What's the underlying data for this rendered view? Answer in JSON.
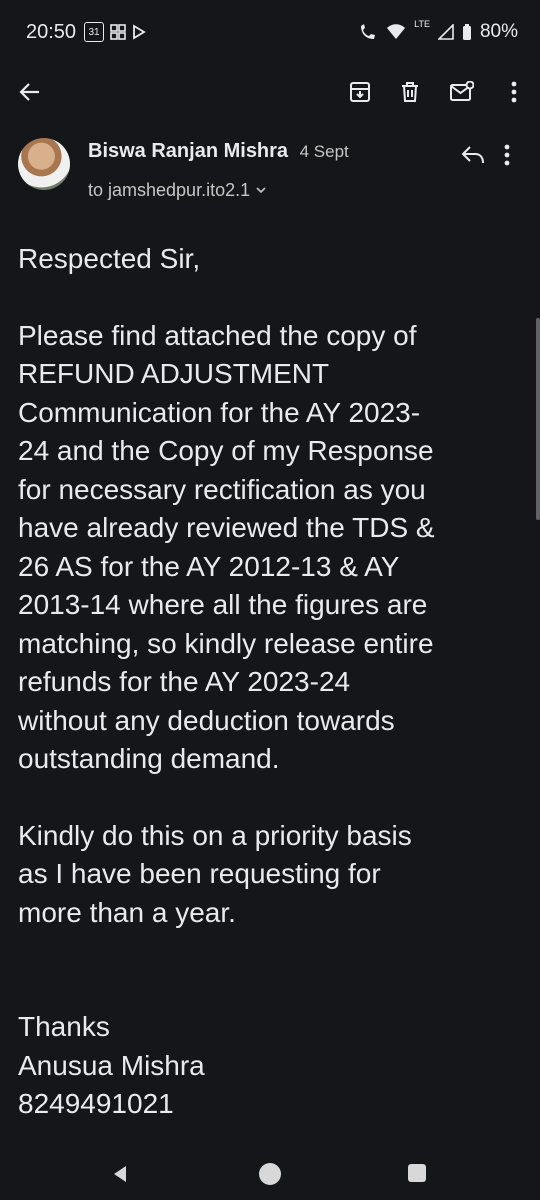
{
  "status_bar": {
    "time": "20:50",
    "calendar_day": "31",
    "network_label": "LTE",
    "battery": "80%"
  },
  "toolbar": {
    "icons": [
      "back-arrow-icon",
      "archive-icon",
      "delete-icon",
      "mark-unread-icon",
      "more-vert-icon"
    ]
  },
  "email": {
    "sender_name": "Biswa Ranjan Mishra",
    "date": "4 Sept",
    "to_line": "to jamshedpur.ito2.1",
    "body": {
      "greeting": "Respected Sir,",
      "paragraph1_lines": [
        "Please find attached the copy of",
        "REFUND ADJUSTMENT",
        "Communication for the AY 2023-",
        "24 and the Copy of my Response",
        "for necessary rectification as you",
        "have already reviewed the TDS &",
        "26 AS for the AY 2012-13 & AY",
        "2013-14 where all the figures are",
        "matching, so kindly release entire",
        "refunds for the AY 2023-24",
        "without any deduction towards",
        "outstanding demand."
      ],
      "paragraph2_lines": [
        "Kindly do this on a priority basis",
        "as I have been requesting for",
        "more than a year."
      ],
      "signoff": "Thanks",
      "signature_name": "Anusua Mishra",
      "signature_phone": "8249491021"
    }
  }
}
